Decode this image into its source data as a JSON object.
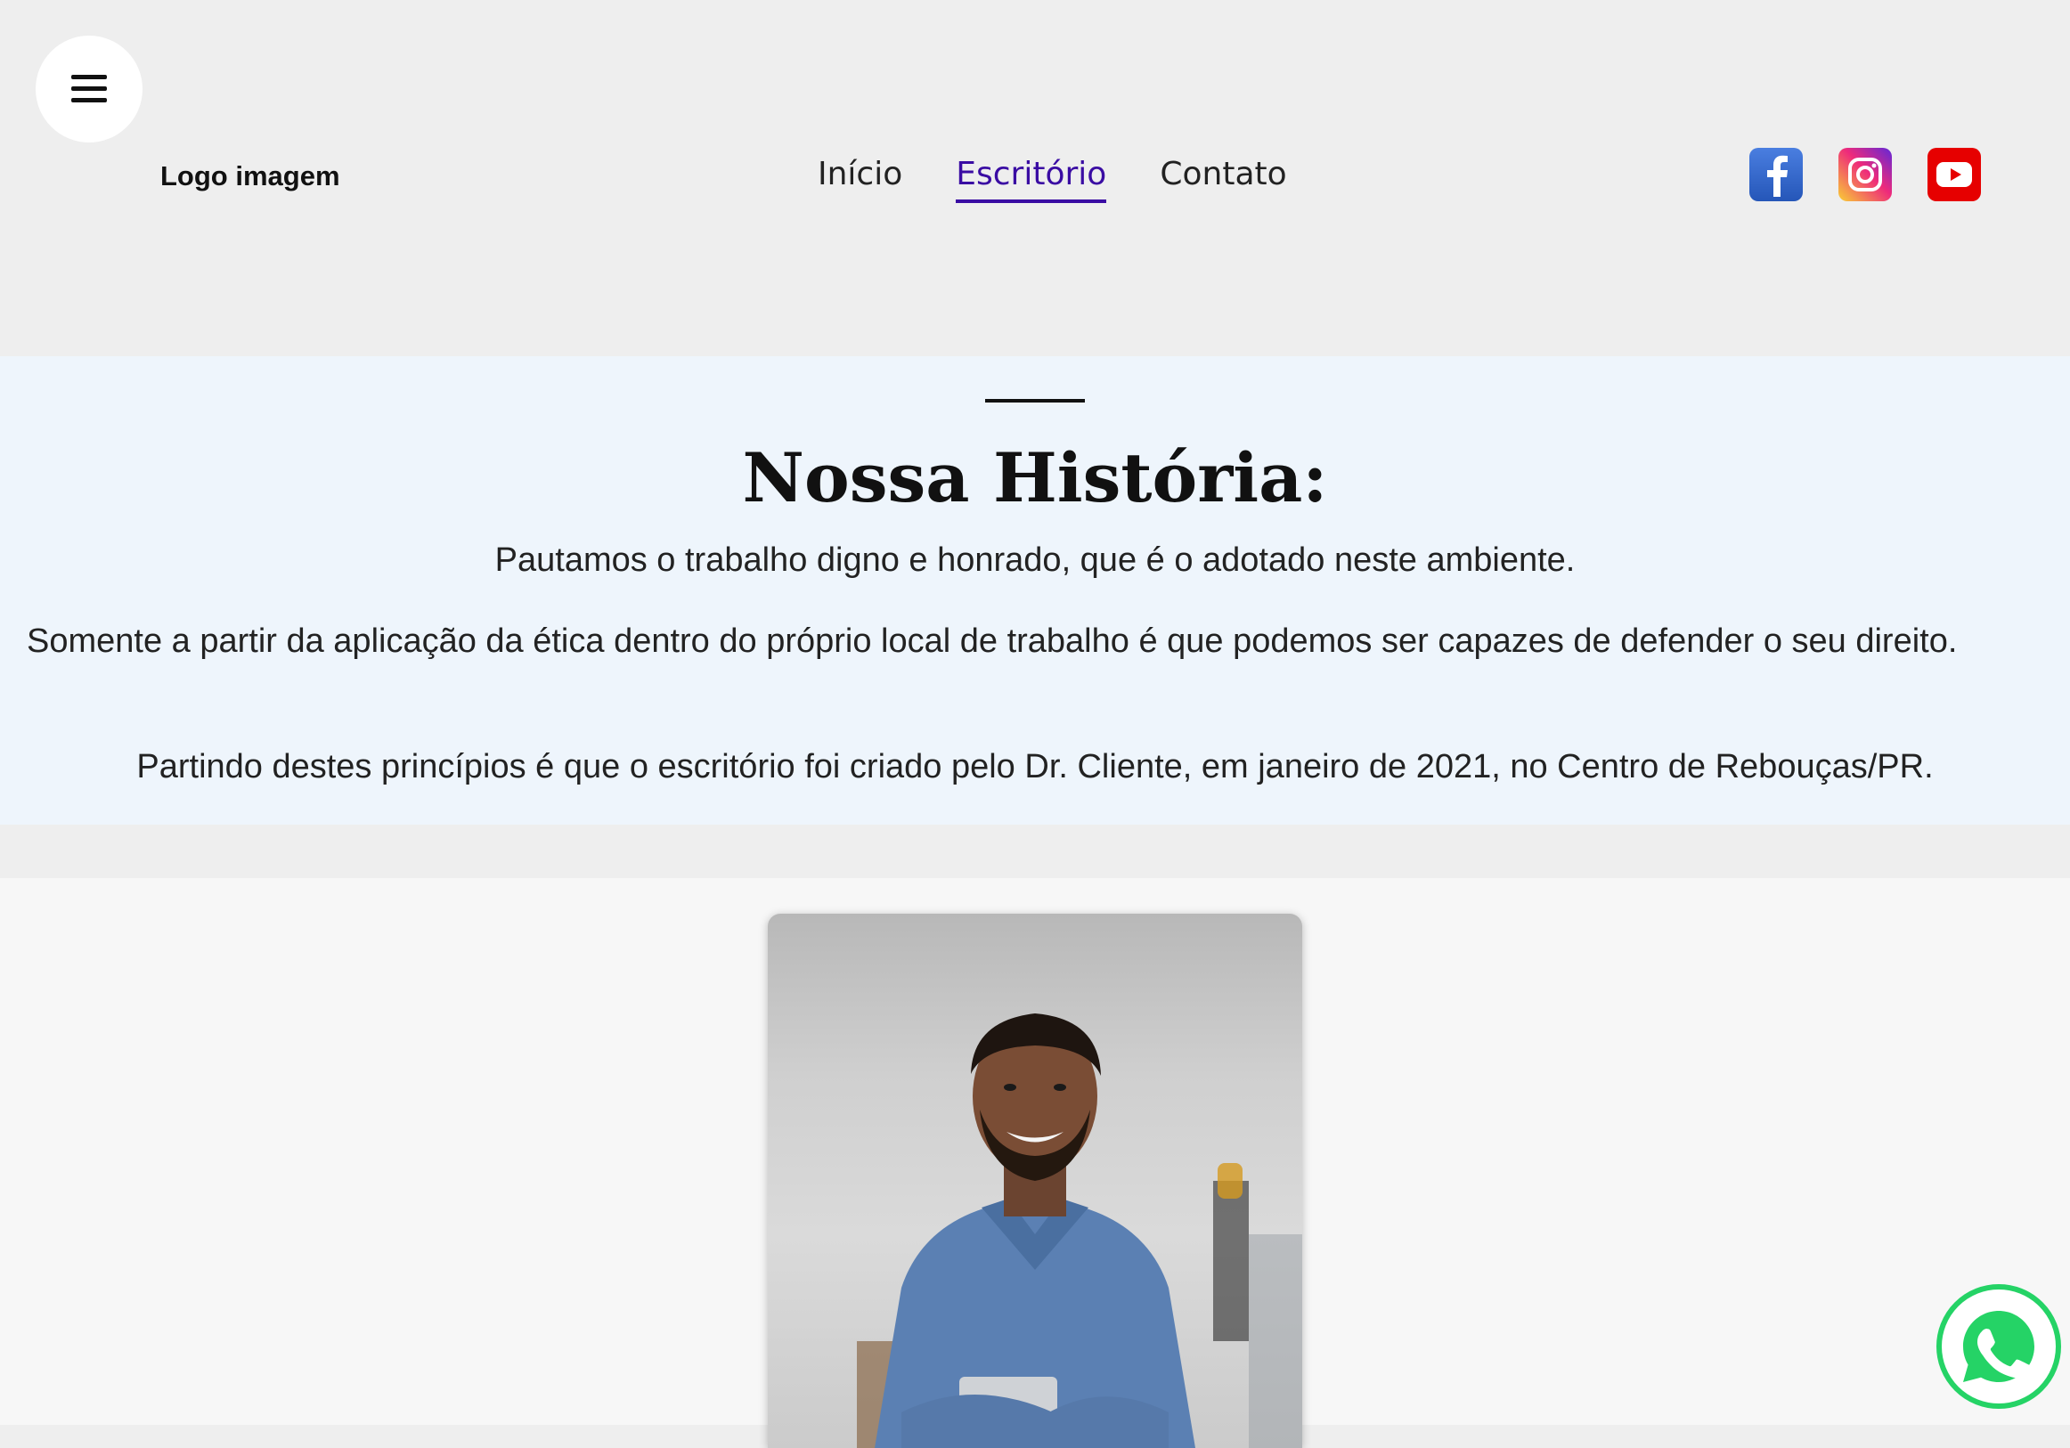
{
  "header": {
    "logo_text": "Logo imagem",
    "nav": [
      {
        "label": "Início",
        "active": false
      },
      {
        "label": "Escritório",
        "active": true
      },
      {
        "label": "Contato",
        "active": false
      }
    ],
    "socials": [
      {
        "icon": "facebook-icon",
        "color": "#2f63c8"
      },
      {
        "icon": "instagram-icon",
        "color": "#e1306c"
      },
      {
        "icon": "youtube-icon",
        "color": "#e60000"
      }
    ],
    "accent_color": "#3a0ca3"
  },
  "history": {
    "title": "Nossa História:",
    "paragraphs": [
      "Pautamos o trabalho digno e honrado, que é o adotado neste ambiente.",
      "Somente a partir da aplicação da ética dentro do próprio local de trabalho é que podemos ser capazes de defender o seu direito.",
      "Partindo destes princípios é que o escritório foi criado pelo Dr. Cliente, em janeiro de 2021, no Centro de Rebouças/PR."
    ]
  },
  "floating": {
    "whatsapp_icon": "whatsapp-icon",
    "whatsapp_color": "#25d366"
  }
}
